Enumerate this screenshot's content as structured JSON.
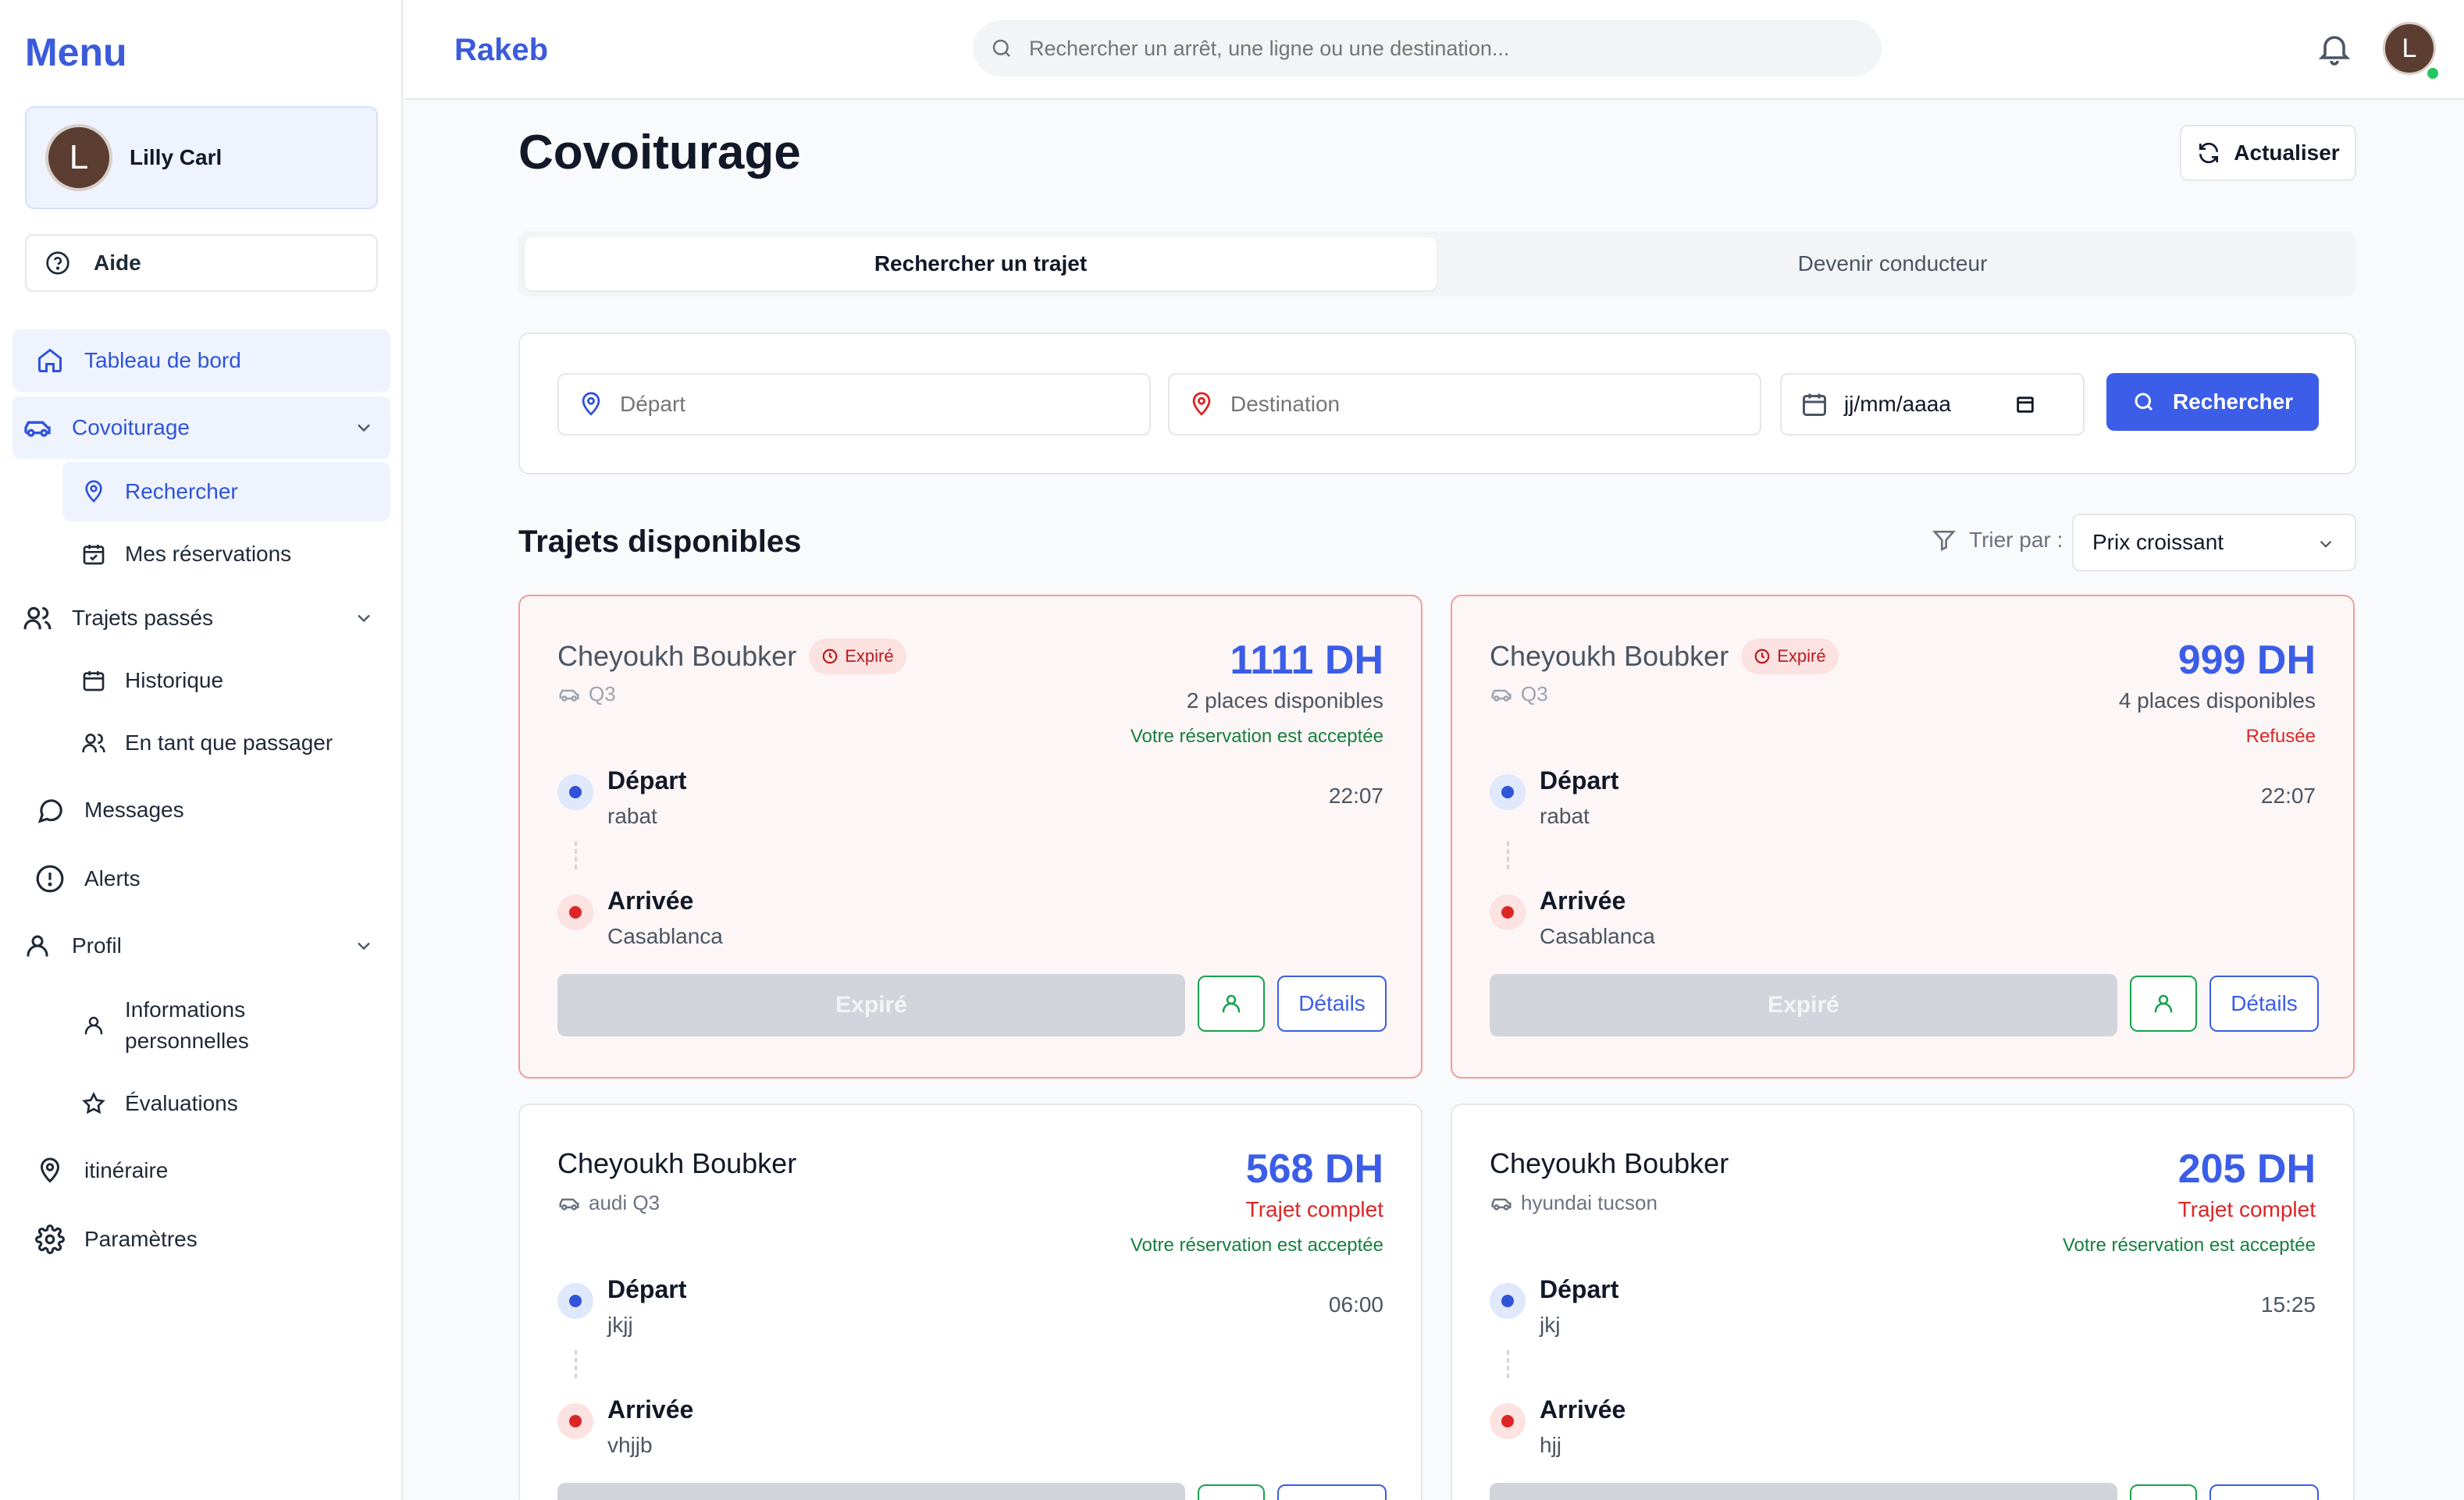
{
  "sidebar": {
    "title": "Menu",
    "user": {
      "initial": "L",
      "name": "Lilly Carl"
    },
    "help_label": "Aide",
    "nav": {
      "dashboard": "Tableau de bord",
      "carpool": "Covoiturage",
      "carpool_search": "Rechercher",
      "carpool_bookings": "Mes réservations",
      "past_trips": "Trajets passés",
      "history": "Historique",
      "as_passenger": "En tant que passager",
      "messages": "Messages",
      "alerts": "Alerts",
      "profile": "Profil",
      "personal_info_1": "Informations",
      "personal_info_2": "personnelles",
      "ratings": "Évaluations",
      "route": "itinéraire",
      "settings": "Paramètres"
    }
  },
  "topbar": {
    "brand": "Rakeb",
    "search_placeholder": "Rechercher un arrêt, une ligne ou une destination...",
    "avatar_initial": "L"
  },
  "main": {
    "title": "Covoiturage",
    "refresh_label": "Actualiser",
    "tabs": [
      "Rechercher un trajet",
      "Devenir conducteur"
    ],
    "form": {
      "departure_placeholder": "Départ",
      "destination_placeholder": "Destination",
      "date_value": "jj/mm/aaaa",
      "search_label": "Rechercher"
    },
    "section_title": "Trajets disponibles",
    "sort_label": "Trier par :",
    "sort_value": "Prix croissant",
    "labels": {
      "departure": "Départ",
      "arrival": "Arrivée",
      "details": "Détails"
    },
    "trips": [
      {
        "driver": "Cheyoukh Boubker",
        "badge": "Expiré",
        "car": "Q3",
        "price": "1111 DH",
        "places": "2 places disponibles",
        "reservation": "Votre réservation est acceptée",
        "from": "rabat",
        "to": "Casablanca",
        "time": "22:07",
        "action": "Expiré"
      },
      {
        "driver": "Cheyoukh Boubker",
        "badge": "Expiré",
        "car": "Q3",
        "price": "999 DH",
        "places": "4 places disponibles",
        "reservation": "Refusée",
        "from": "rabat",
        "to": "Casablanca",
        "time": "22:07",
        "action": "Expiré"
      },
      {
        "driver": "Cheyoukh Boubker",
        "car": "audi Q3",
        "price": "568 DH",
        "places": "Trajet complet",
        "reservation": "Votre réservation est acceptée",
        "from": "jkjj",
        "to": "vhjjb",
        "time": "06:00"
      },
      {
        "driver": "Cheyoukh Boubker",
        "car": "hyundai tucson",
        "price": "205 DH",
        "places": "Trajet complet",
        "reservation": "Votre réservation est acceptée",
        "from": "jkj",
        "to": "hjj",
        "time": "15:25"
      }
    ]
  },
  "colors": {
    "accent": "#3b5de7",
    "success": "#15803d",
    "danger": "#dc2626",
    "expired_border": "#f19d9d"
  }
}
